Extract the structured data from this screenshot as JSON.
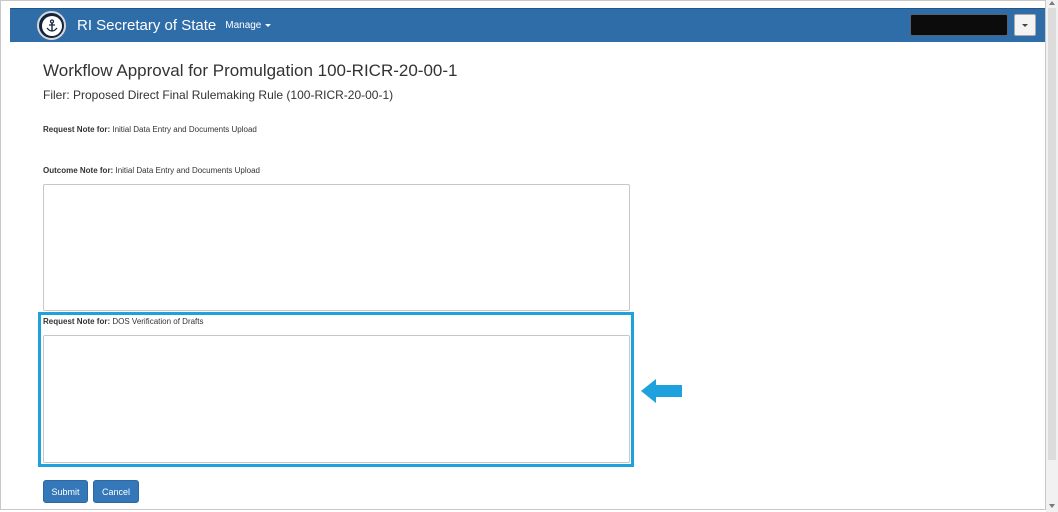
{
  "nav": {
    "brand": "RI Secretary of State",
    "manage": "Manage",
    "brand_color": "#2f6da9",
    "seal_icon": "anchor-seal-icon",
    "user_menu_icon": "caret-down-icon"
  },
  "page": {
    "title": "Workflow Approval for Promulgation 100-RICR-20-00-1",
    "subtitle": "Filer: Proposed Direct Final Rulemaking Rule (100-RICR-20-00-1)"
  },
  "notes": [
    {
      "label": "Request Note for:",
      "text": "Initial Data Entry and Documents Upload"
    },
    {
      "label": "Outcome Note for:",
      "text": "Initial Data Entry and Documents Upload",
      "value": ""
    },
    {
      "label": "Request Note for:",
      "text": "DOS Verification of Drafts",
      "value": ""
    }
  ],
  "actions": {
    "submit": "Submit",
    "cancel": "Cancel"
  },
  "annotation": {
    "highlight_color": "#1ea1dc",
    "arrow_icon": "left-arrow-icon"
  }
}
